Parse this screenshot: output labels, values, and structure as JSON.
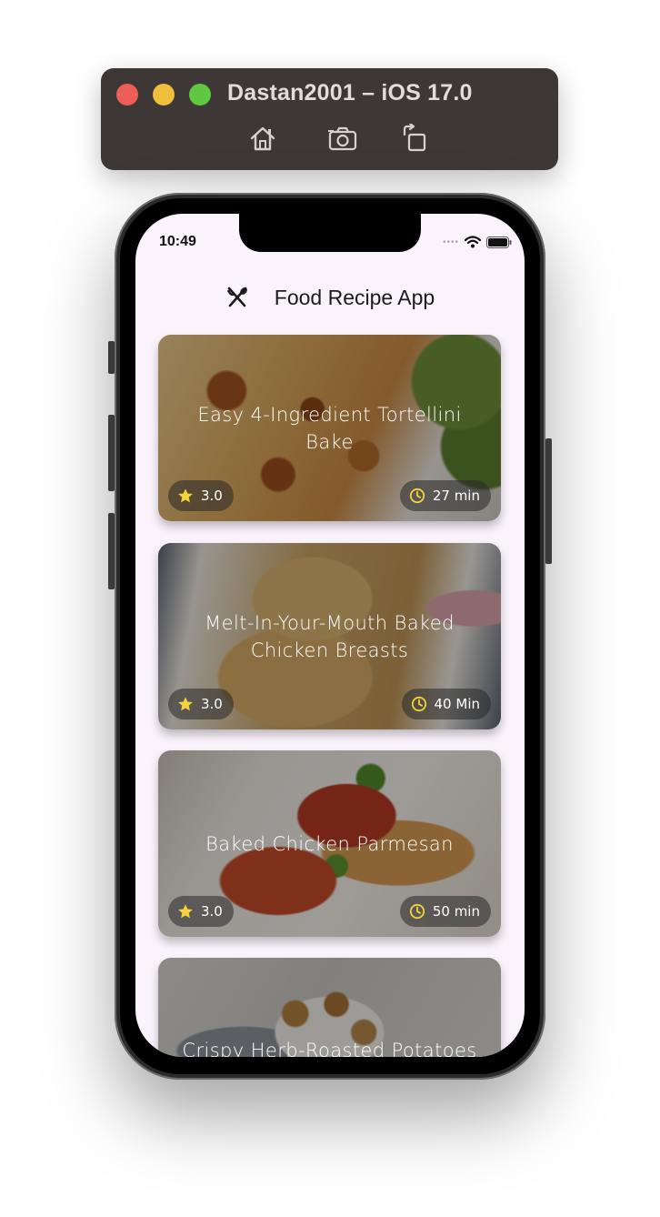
{
  "simulator": {
    "title": "Dastan2001 – iOS 17.0",
    "buttons": [
      "home-icon",
      "screenshot-icon",
      "rotate-icon"
    ]
  },
  "status_bar": {
    "time": "10:49"
  },
  "app": {
    "title": "Food Recipe App",
    "header_icon": "cutlery-icon"
  },
  "recipes": [
    {
      "title": "Easy 4-Ingredient Tortellini Bake",
      "rating": "3.0",
      "time": "27 min"
    },
    {
      "title": "Melt-In-Your-Mouth Baked Chicken Breasts",
      "rating": "3.0",
      "time": "40 Min"
    },
    {
      "title": "Baked Chicken Parmesan",
      "rating": "3.0",
      "time": "50 min"
    },
    {
      "title": "Crispy Herb-Roasted Potatoes"
    }
  ],
  "colors": {
    "screen_background": "#fbf3fc",
    "star": "#f5d33a",
    "clock": "#f5d33a",
    "toolbar": "#3d3835"
  }
}
